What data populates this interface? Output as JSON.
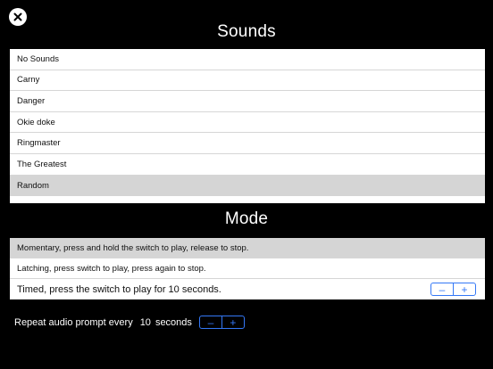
{
  "close_icon": "close-circle-icon",
  "sounds": {
    "title": "Sounds",
    "items": [
      {
        "label": "No Sounds"
      },
      {
        "label": "Carny"
      },
      {
        "label": "Danger"
      },
      {
        "label": "Okie doke"
      },
      {
        "label": "Ringmaster"
      },
      {
        "label": "The Greatest"
      },
      {
        "label": "Random",
        "selected": true
      }
    ]
  },
  "mode": {
    "title": "Mode",
    "options": [
      {
        "label": "Momentary, press and hold the switch to play, release to stop.",
        "selected": true
      },
      {
        "label": "Latching, press switch to play, press again to stop."
      },
      {
        "label": "Timed, press the switch to play for 10 seconds."
      }
    ],
    "timed_stepper": {
      "minus": "–",
      "plus": "+"
    }
  },
  "repeat": {
    "label": "Repeat audio prompt every",
    "value": "10",
    "unit": "seconds",
    "stepper": {
      "minus": "–",
      "plus": "+"
    }
  },
  "colors": {
    "accent": "#3478f6",
    "selected_row": "#d5d5d5",
    "background": "#000000"
  }
}
